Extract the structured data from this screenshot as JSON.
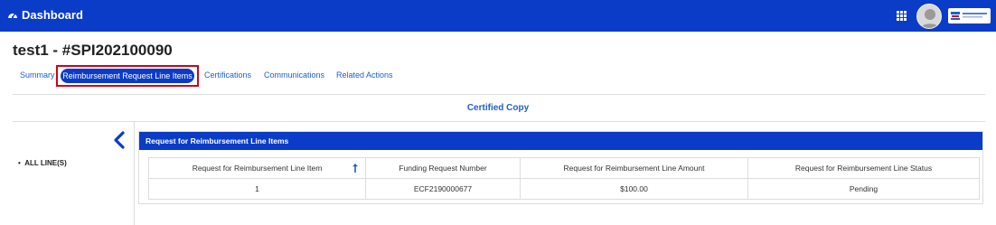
{
  "topbar": {
    "title": "Dashboard",
    "colors": {
      "bar": "#0a3cc8",
      "text": "#ffffff"
    }
  },
  "page": {
    "title": "test1 - #SPI202100090"
  },
  "tabs": [
    {
      "label": "Summary",
      "active": false
    },
    {
      "label": "Reimbursement Request Line Items",
      "active": true
    },
    {
      "label": "Certifications",
      "active": false
    },
    {
      "label": "Communications",
      "active": false
    },
    {
      "label": "Related Actions",
      "active": false
    }
  ],
  "banner": {
    "text": "Certified Copy"
  },
  "sidebar": {
    "item": "ALL LINE(S)"
  },
  "panel": {
    "header": "Request for Reimbursement Line Items",
    "columns": [
      "Request for Reimbursement Line Item",
      "Funding Request Number",
      "Request for Reimbursement Line Amount",
      "Request for Reimbursement Line Status"
    ],
    "rows": [
      [
        "1",
        "ECF2190000677",
        "$100.00",
        "Pending"
      ]
    ]
  },
  "icons": [
    "tachometer-icon",
    "apps-grid-icon",
    "user-avatar-icon",
    "org-logo",
    "chevron-left-icon",
    "sort-up-icon"
  ],
  "accent": "#0a3cc8",
  "highlight": "#d0021b"
}
